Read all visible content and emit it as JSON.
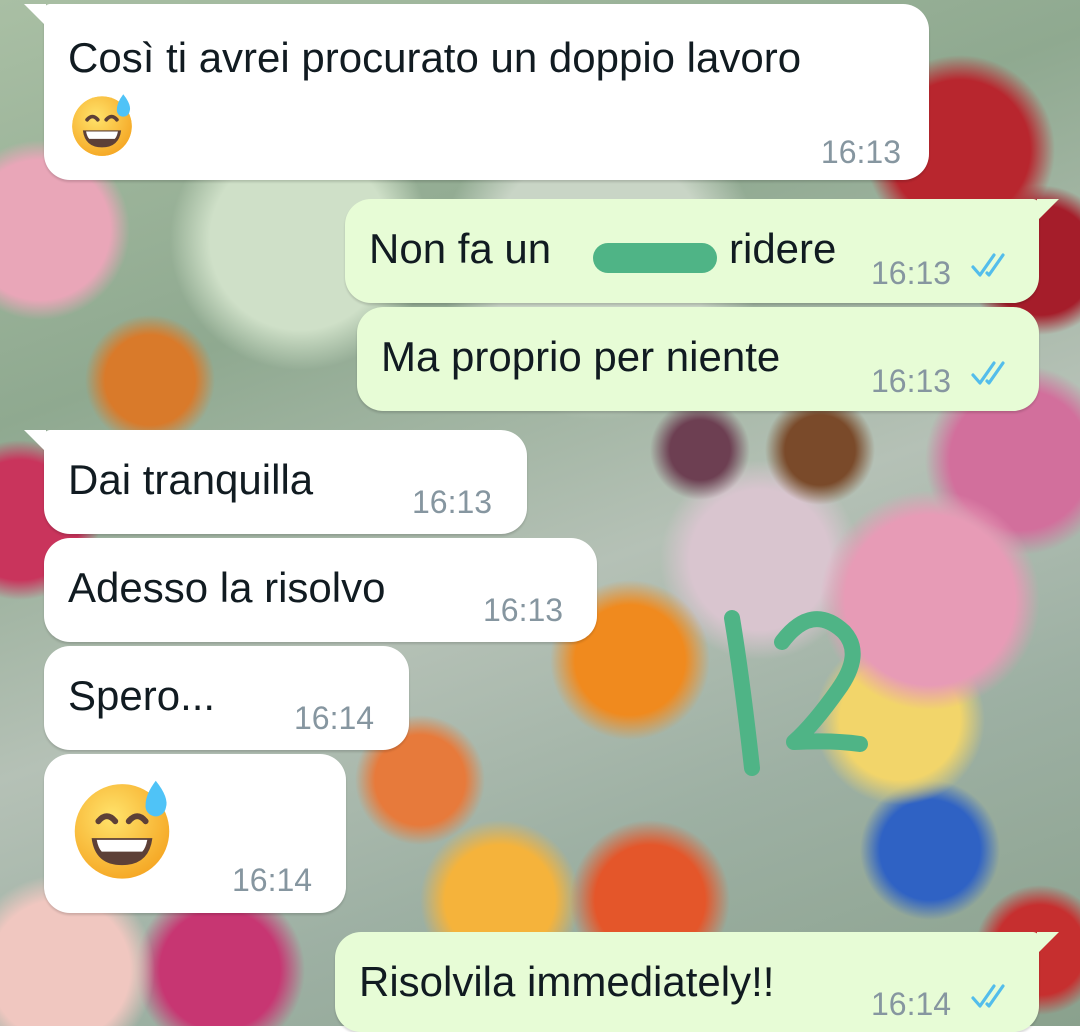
{
  "messages": [
    {
      "direction": "incoming",
      "text": "Così ti avrei procurato un doppio lavoro",
      "emoji": "grinning-face-with-sweat-icon",
      "time": "16:13"
    },
    {
      "direction": "outgoing",
      "text_before": "Non fa un",
      "text_after": "ridere",
      "time": "16:13",
      "status": "read"
    },
    {
      "direction": "outgoing",
      "text": "Ma proprio per niente",
      "time": "16:13",
      "status": "read"
    },
    {
      "direction": "incoming",
      "text": "Dai tranquilla",
      "time": "16:13"
    },
    {
      "direction": "incoming",
      "text": "Adesso la risolvo",
      "time": "16:13"
    },
    {
      "direction": "incoming",
      "text": "Spero...",
      "time": "16:14"
    },
    {
      "direction": "incoming",
      "emoji": "grinning-face-with-sweat-icon",
      "time": "16:14"
    },
    {
      "direction": "outgoing",
      "text": "Risolvila immediately!!",
      "time": "16:14",
      "status": "read"
    }
  ],
  "annotation": {
    "text": "12",
    "color": "#4fb486"
  },
  "colors": {
    "incoming_bubble": "#ffffff",
    "outgoing_bubble": "#e7fcd6",
    "timestamp": "#8696a0",
    "read_ticks": "#53bdeb",
    "censor_mark": "#4fb486"
  }
}
